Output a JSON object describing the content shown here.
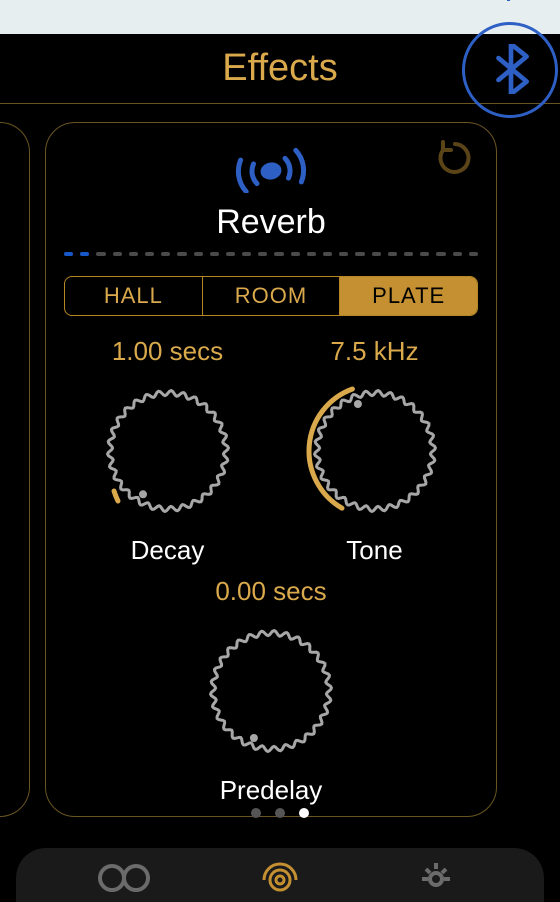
{
  "header": {
    "title": "Effects"
  },
  "effect": {
    "name": "Reverb",
    "modes": [
      {
        "label": "HALL",
        "active": false
      },
      {
        "label": "ROOM",
        "active": false
      },
      {
        "label": "PLATE",
        "active": true
      }
    ],
    "progress_segments_total": 26,
    "progress_segments_active": 2,
    "knobs": {
      "decay": {
        "value": "1.00 secs",
        "label": "Decay",
        "indicator_deg": 210,
        "arc_on": false
      },
      "tone": {
        "value": "7.5 kHz",
        "label": "Tone",
        "indicator_deg": -20,
        "arc_on": true
      },
      "predelay": {
        "value": "0.00 secs",
        "label": "Predelay",
        "indicator_deg": 200,
        "arc_on": false
      }
    }
  },
  "pager": {
    "count": 3,
    "active_index": 2
  },
  "colors": {
    "accent": "#d9a94c",
    "accent_dark": "#6a5522",
    "blue": "#2d5fc5",
    "dial": "#a7a7a7"
  }
}
